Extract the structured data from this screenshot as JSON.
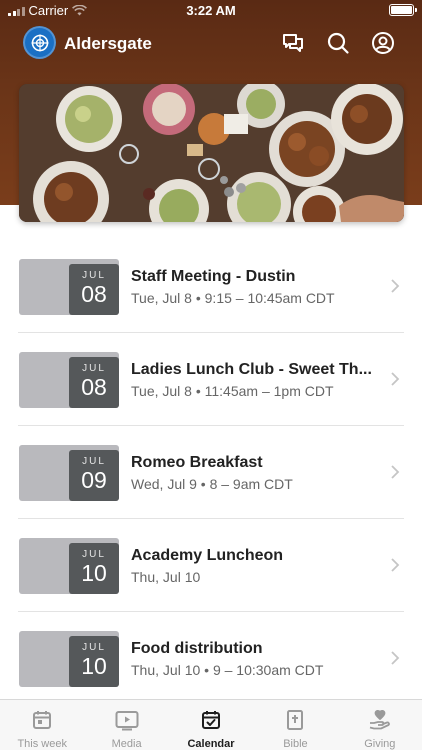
{
  "status_bar": {
    "carrier": "Carrier",
    "time": "3:22 AM",
    "battery_level": 1.0
  },
  "header": {
    "app_name": "Aldersgate",
    "icons": [
      "logo-icon",
      "chat-icon",
      "search-icon",
      "profile-icon"
    ],
    "background_color": "#6b3518"
  },
  "events": [
    {
      "month": "JUL",
      "day": "08",
      "title": "Staff Meeting - Dustin",
      "subtitle": "Tue, Jul 8 • 9:15 – 10:45am CDT"
    },
    {
      "month": "JUL",
      "day": "08",
      "title": "Ladies Lunch Club - Sweet Th...",
      "subtitle": "Tue, Jul 8 • 11:45am – 1pm CDT"
    },
    {
      "month": "JUL",
      "day": "09",
      "title": "Romeo Breakfast",
      "subtitle": "Wed, Jul 9 • 8 – 9am CDT"
    },
    {
      "month": "JUL",
      "day": "10",
      "title": "Academy Luncheon",
      "subtitle": "Thu, Jul 10"
    },
    {
      "month": "JUL",
      "day": "10",
      "title": "Food distribution",
      "subtitle": "Thu, Jul 10 • 9 – 10:30am CDT"
    }
  ],
  "tabbar": {
    "active": "Calendar",
    "tabs": [
      {
        "label": "This week",
        "icon": "calendar-day-icon"
      },
      {
        "label": "Media",
        "icon": "play-icon"
      },
      {
        "label": "Calendar",
        "icon": "calendar-check-icon"
      },
      {
        "label": "Bible",
        "icon": "bible-icon"
      },
      {
        "label": "Giving",
        "icon": "heart-hand-icon"
      }
    ]
  }
}
